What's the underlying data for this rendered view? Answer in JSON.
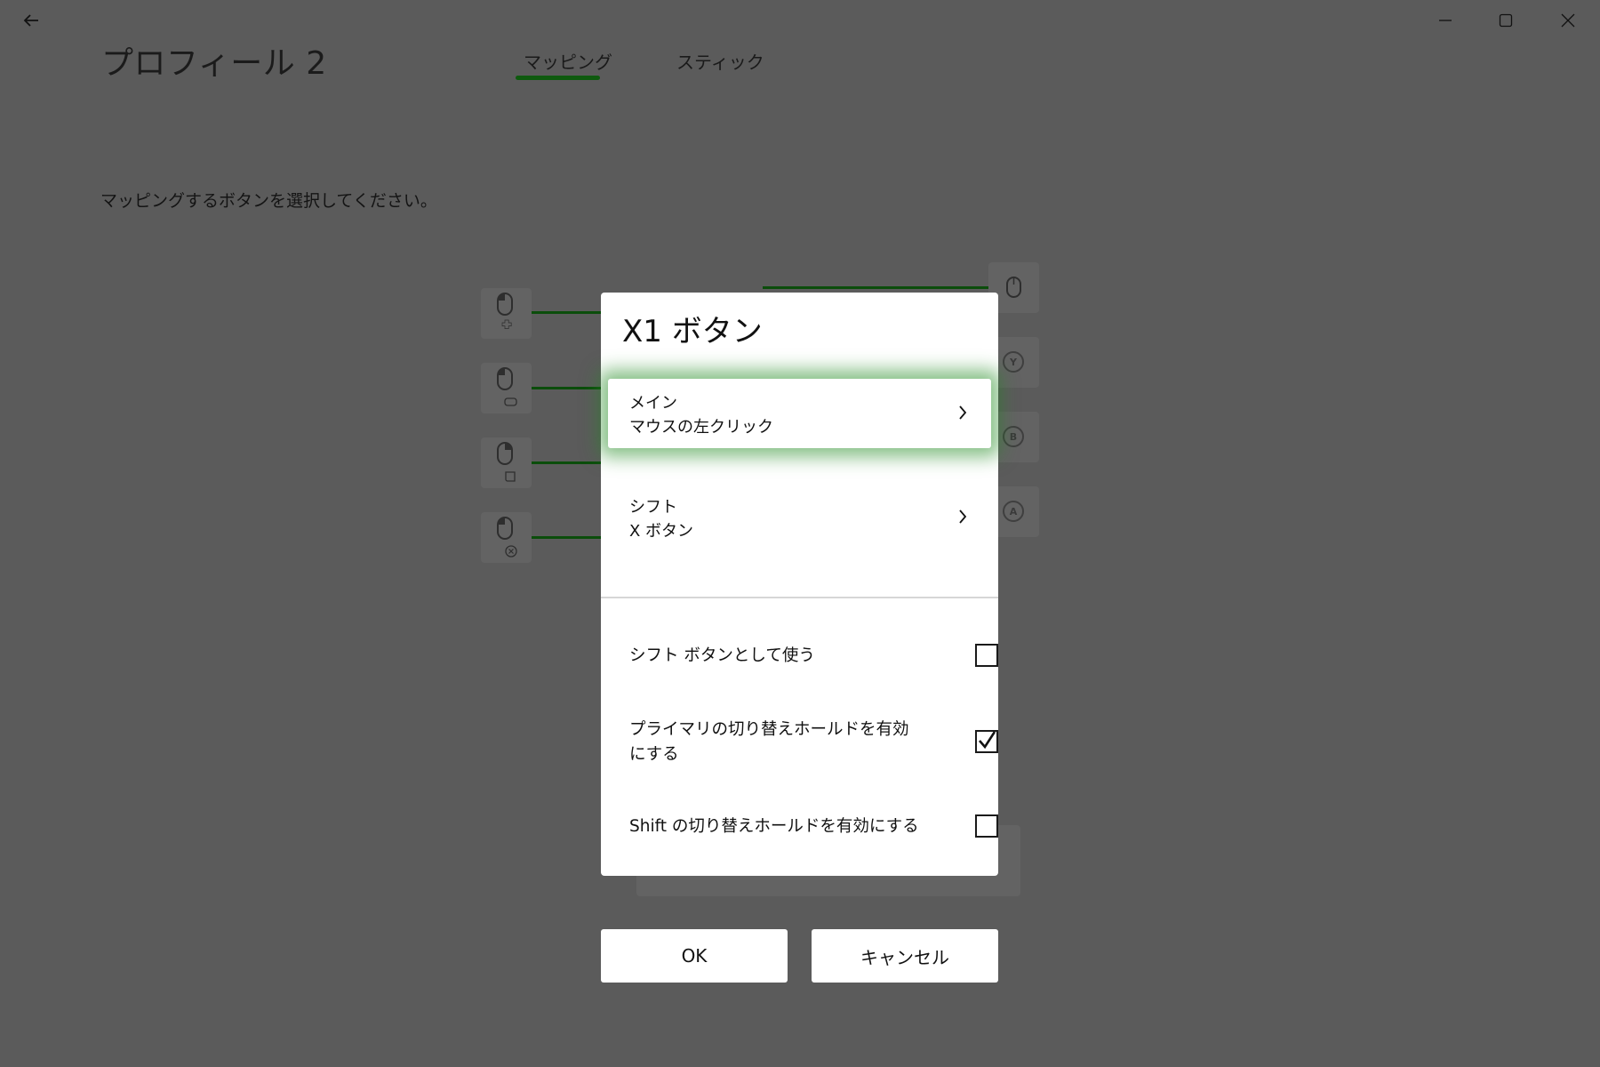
{
  "window": {
    "back_icon": "arrow-left-icon",
    "controls": [
      "minimize-icon",
      "maximize-icon",
      "close-icon"
    ]
  },
  "header": {
    "title": "プロフィール 2",
    "tabs": [
      {
        "label": "マッピング",
        "active": true
      },
      {
        "label": "スティック",
        "active": false
      }
    ]
  },
  "main": {
    "instructions": "マッピングするボタンを選択してください。",
    "left_buttons": [
      "mouse-dpad-icon",
      "mouse-lb-icon",
      "mouse-lt-icon",
      "mouse-x-icon"
    ],
    "right_buttons": [
      {
        "icon": "mouse-icon"
      },
      {
        "icon": "y-button-icon",
        "letter": "Y"
      },
      {
        "icon": "b-button-icon",
        "letter": "B"
      },
      {
        "icon": "a-button-icon",
        "letter": "A"
      }
    ]
  },
  "dialog": {
    "title": "X1 ボタン",
    "options": [
      {
        "label": "メイン",
        "value": "マウスの左クリック",
        "selected": true
      },
      {
        "label": "シフト",
        "value": "X ボタン",
        "selected": false
      }
    ],
    "checkboxes": [
      {
        "label": "シフト ボタンとして使う",
        "checked": false
      },
      {
        "label": "プライマリの切り替えホールドを有効にする",
        "checked": true
      },
      {
        "label": "Shift の切り替えホールドを有効にする",
        "checked": false
      }
    ],
    "ok_label": "OK",
    "cancel_label": "キャンセル"
  },
  "colors": {
    "background": "#5b5b5b",
    "accent": "#0e5a0e",
    "glow": "#228b22",
    "surface": "#ffffff"
  }
}
